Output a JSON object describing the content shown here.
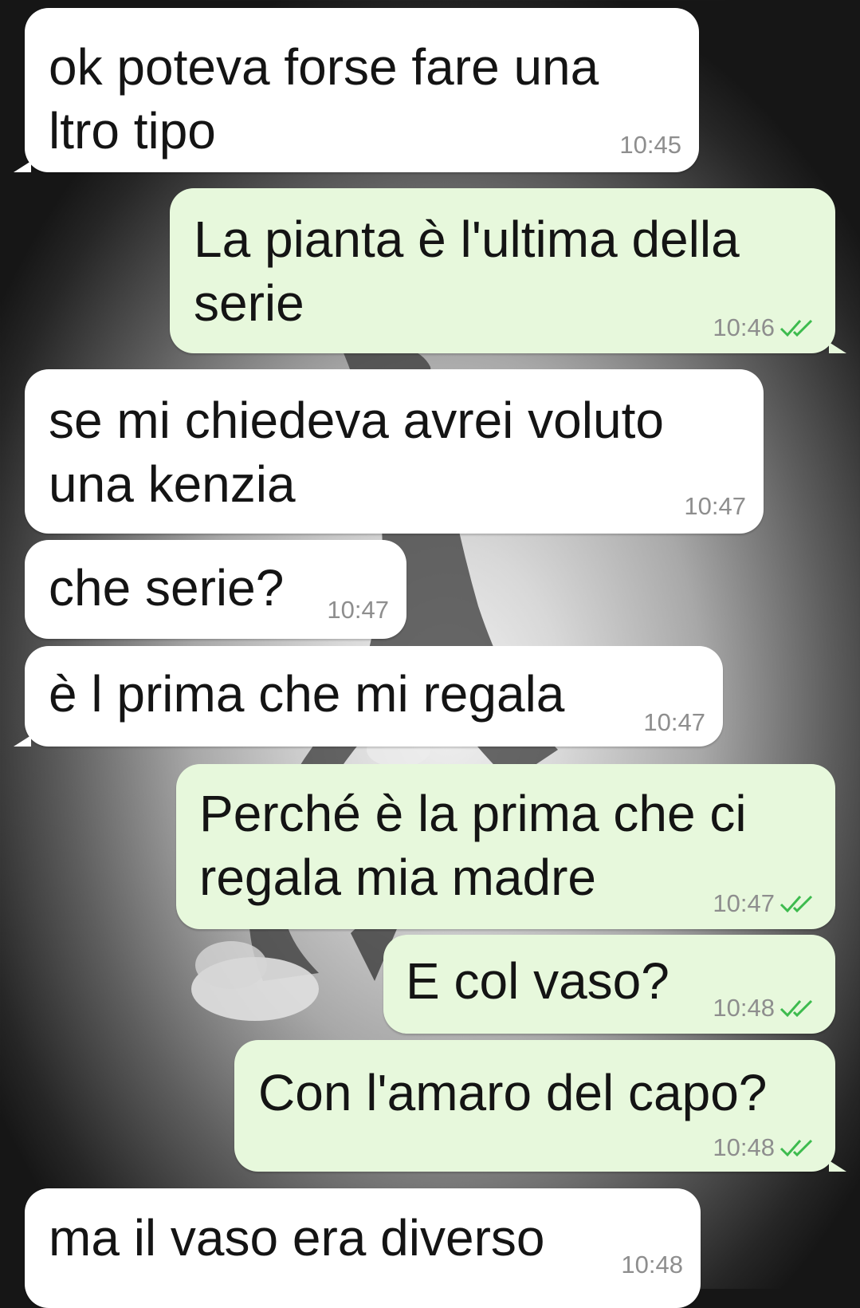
{
  "colors": {
    "incoming_bubble": "#ffffff",
    "outgoing_bubble": "#e7f8dc",
    "text": "#141414",
    "timestamp": "#8e8e8e",
    "read_ticks": "#3dbb4e"
  },
  "messages": [
    {
      "direction": "incoming",
      "text": "ok poteva forse fare una\nltro tipo",
      "time": "10:45"
    },
    {
      "direction": "outgoing",
      "text": "La pianta è l'ultima della\nserie",
      "time": "10:46",
      "status_icon": "double-check-icon"
    },
    {
      "direction": "incoming",
      "text": "se mi chiedeva avrei voluto\nuna kenzia",
      "time": "10:47"
    },
    {
      "direction": "incoming",
      "text": "che serie?",
      "time": "10:47"
    },
    {
      "direction": "incoming",
      "text": "è l prima che mi regala",
      "time": "10:47"
    },
    {
      "direction": "outgoing",
      "text": "Perché è la prima che ci\nregala mia madre",
      "time": "10:47",
      "status_icon": "double-check-icon"
    },
    {
      "direction": "outgoing",
      "text": "E col vaso?",
      "time": "10:48",
      "status_icon": "double-check-icon"
    },
    {
      "direction": "outgoing",
      "text": "Con l'amaro del capo?",
      "time": "10:48",
      "status_icon": "double-check-icon"
    },
    {
      "direction": "incoming",
      "text": "ma il vaso era diverso",
      "time": "10:48"
    }
  ]
}
